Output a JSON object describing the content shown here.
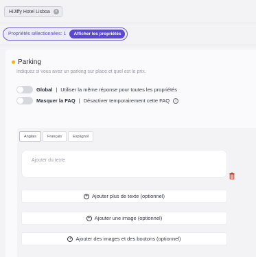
{
  "header": {
    "hotel_chip": "HiJiffy Hotel Lisboa",
    "chip_remove_icon": "close-circle-icon"
  },
  "selection": {
    "label": "Propriétés sélectionnées: 1",
    "show_button": "Afficher les propriétés"
  },
  "faq": {
    "title": "Parking",
    "status_dot_color": "#f5b400",
    "description": "Indiquez si vous avez un parking sur place et quel est le prix.",
    "global_toggle": {
      "label": "Global",
      "separator": "|",
      "text": "Utiliser la même réponse pour toutes les propriétés",
      "on": false
    },
    "hide_toggle": {
      "label": "Masquer la FAQ",
      "separator": "|",
      "text": "Désactiver temporairement cette FAQ",
      "info_icon": "info-circle-icon",
      "on": false
    }
  },
  "editor": {
    "tabs": [
      {
        "label": "Anglais",
        "active": true
      },
      {
        "label": "Français",
        "active": false
      },
      {
        "label": "Espagnol",
        "active": false
      }
    ],
    "text_placeholder": "Ajouter du texte",
    "delete_icon": "trash-icon",
    "actions": {
      "add_text": "Ajouter plus de texte (optionnel)",
      "add_image": "Ajouter une image (optionnel)",
      "add_images_buttons": "Ajouter des images et des boutons (optionnel)"
    }
  },
  "colors": {
    "accent": "#5b46d6",
    "delete": "#c0392b"
  }
}
